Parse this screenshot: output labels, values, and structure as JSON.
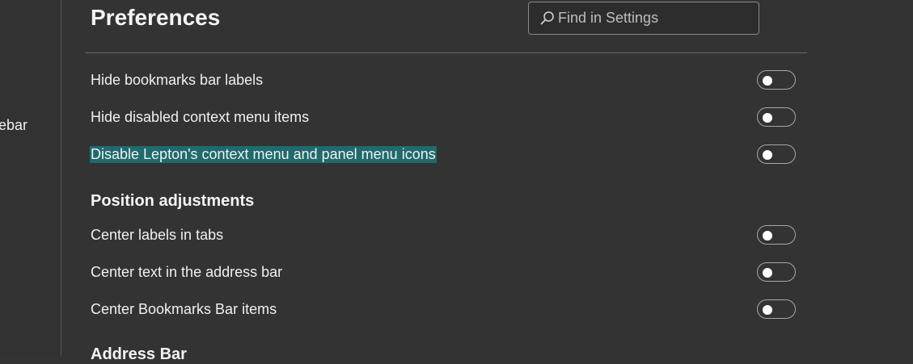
{
  "sidebar": {
    "visible_item_label": "ebar"
  },
  "header": {
    "title": "Preferences",
    "search": {
      "placeholder": "Find in Settings",
      "value": ""
    }
  },
  "settings": [
    {
      "label": "Hide bookmarks bar labels",
      "enabled": false
    },
    {
      "label": "Hide disabled context menu items",
      "enabled": false
    },
    {
      "label": "Disable Lepton's context menu and panel menu icons",
      "enabled": false,
      "highlighted": true
    }
  ],
  "sections": [
    {
      "heading": "Position adjustments",
      "settings": [
        {
          "label": "Center labels in tabs",
          "enabled": false
        },
        {
          "label": "Center text in the address bar",
          "enabled": false
        },
        {
          "label": "Center Bookmarks Bar items",
          "enabled": false
        }
      ]
    },
    {
      "heading": "Address Bar"
    }
  ],
  "colors": {
    "background": "#333333",
    "highlight": "#1f6a6c",
    "toggle_border": "#a8a8a8"
  }
}
